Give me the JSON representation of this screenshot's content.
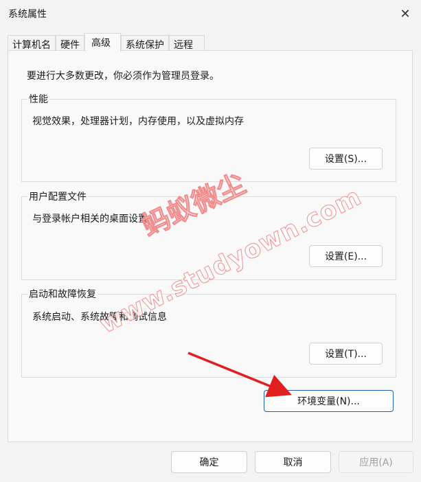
{
  "window": {
    "title": "系统属性",
    "close_symbol": "✕"
  },
  "tabs": [
    {
      "label": "计算机名",
      "active": false
    },
    {
      "label": "硬件",
      "active": false
    },
    {
      "label": "高级",
      "active": true
    },
    {
      "label": "系统保护",
      "active": false
    },
    {
      "label": "远程",
      "active": false
    }
  ],
  "panel": {
    "notice": "要进行大多数更改，你必须作为管理员登录。",
    "groups": [
      {
        "label": "性能",
        "desc": "视觉效果，处理器计划，内存使用，以及虚拟内存",
        "button": "设置(S)..."
      },
      {
        "label": "用户配置文件",
        "desc": "与登录帐户相关的桌面设置",
        "button": "设置(E)..."
      },
      {
        "label": "启动和故障恢复",
        "desc": "系统启动、系统故障和调试信息",
        "button": "设置(T)..."
      }
    ],
    "env_button": "环境变量(N)..."
  },
  "footer": {
    "ok": "确定",
    "cancel": "取消",
    "apply": "应用(A)",
    "apply_disabled": true
  },
  "watermark": {
    "line1": "蚂蚁微尘",
    "line2": "www.studyown.com"
  },
  "annotation_colors": {
    "arrow": "#e02020",
    "watermark_stroke": "#f07878"
  }
}
